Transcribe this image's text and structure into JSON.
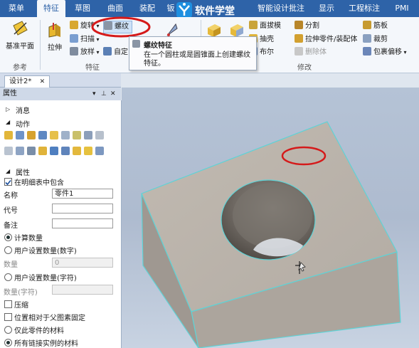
{
  "menubar": {
    "tabs": [
      "菜单",
      "特征",
      "草图",
      "曲面",
      "装配",
      "钣",
      "智能设计批注",
      "显示",
      "工程标注",
      "PMI"
    ],
    "active": "特征"
  },
  "logo": {
    "text": "软件学堂"
  },
  "ribbon": {
    "groups": [
      "参考",
      "特征",
      "修改"
    ],
    "reference": {
      "plane_label": "基准平面"
    },
    "feature": {
      "stretch_label": "拉伸",
      "rotate_label": "旋转",
      "thread_label": "螺纹",
      "sweep_label": "扫描",
      "loft_label": "放样",
      "custom_label": "自定"
    },
    "modify": {
      "face_draft": "面拔模",
      "shell": "抽壳",
      "boolean": "布尔",
      "split": "分割",
      "stretch_part": "拉伸零件/装配体",
      "delete_body": "删除体",
      "rib": "筋板",
      "trim": "裁剪",
      "wrap_offset": "包裹偏移"
    }
  },
  "tooltip": {
    "title": "螺纹特征",
    "description": "在一个圆柱或是圆锥面上创建螺纹特征。"
  },
  "document": {
    "tab_label": "设计2*"
  },
  "panel": {
    "title": "属性",
    "sections": {
      "messages": "消息",
      "actions": "动作",
      "properties": "属性"
    },
    "include_in_bom": "在明细表中包含",
    "name_label": "名称",
    "name_value": "零件1",
    "code_label": "代号",
    "code_value": "",
    "note_label": "备注",
    "note_value": "",
    "calc_qty": "计算数量",
    "user_qty_number": "用户设置数量(数字)",
    "qty_label": "数量",
    "qty_value": "0",
    "user_qty_text": "用户设置数量(字符)",
    "qty_text_label": "数量(字符)",
    "compress": "压缩",
    "fix_relative_parent": "位置相对于父图素固定",
    "part_material_only": "仅此零件的材料",
    "all_linked_material": "所有链接实例的材料"
  },
  "colors": {
    "menubar": "#2e63a8",
    "ribbon_bg": "#f4f7fb",
    "block_top": "#bcb5ad",
    "block_front": "#aca59d",
    "block_side": "#9f9891",
    "edge_highlight": "#5fd3d6",
    "annotation": "#d51a1a",
    "viewport": "#b5c3d6"
  }
}
